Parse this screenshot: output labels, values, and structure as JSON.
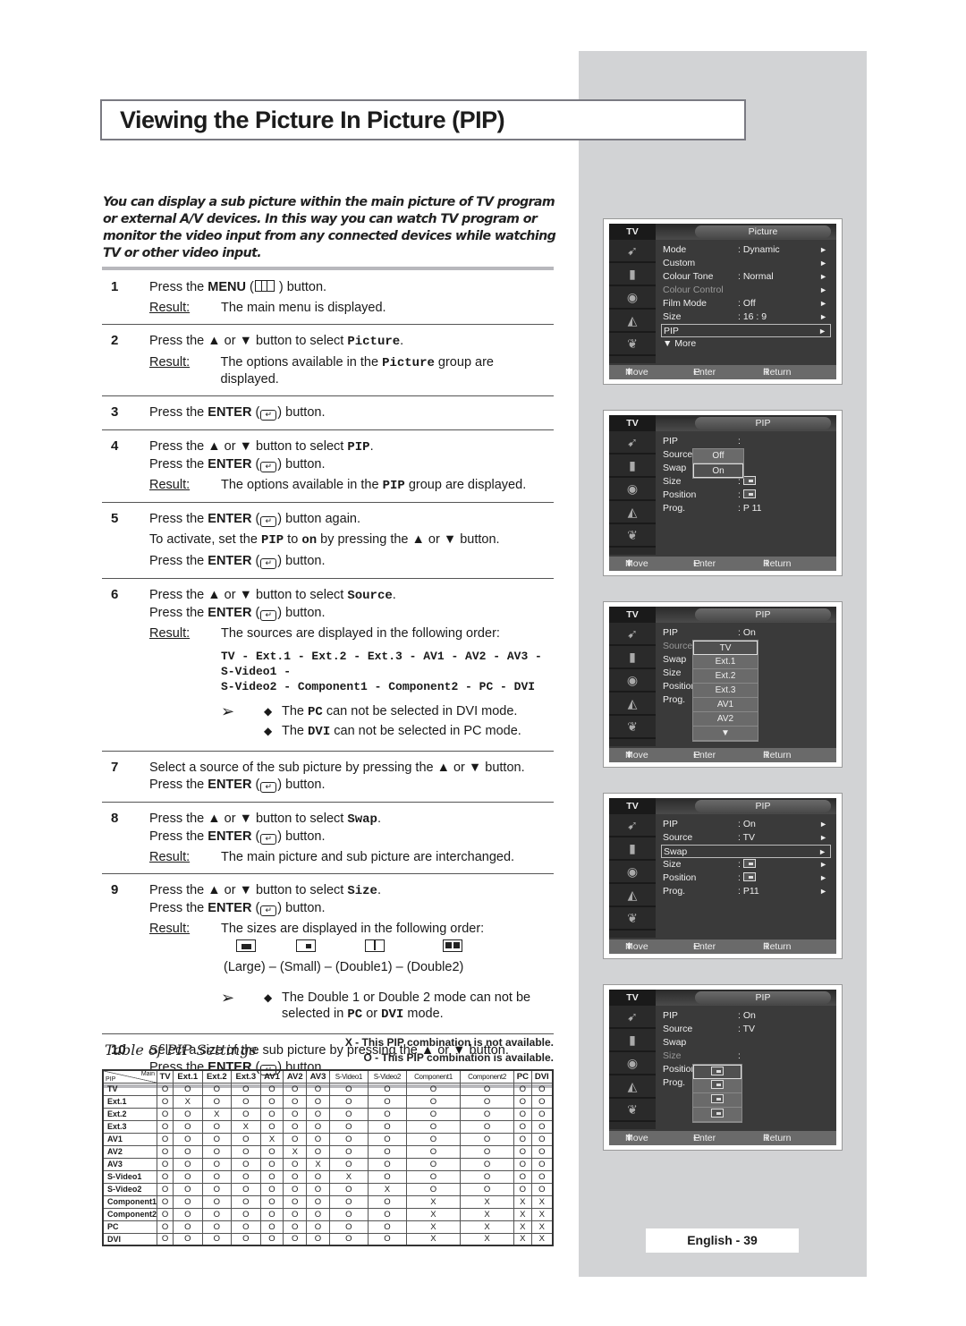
{
  "title": "Viewing the Picture In Picture (PIP)",
  "intro": "You can display a sub picture within the main picture of TV program or external A/V devices. In this way you can watch TV program or monitor the video input from any connected devices while watching TV or other video input.",
  "labels": {
    "result": "Result:",
    "press_the": "Press the",
    "menu": "MENU",
    "enter": "ENTER",
    "up": "▲",
    "down": "▼"
  },
  "steps": [
    {
      "num": "1",
      "lines": [
        "Press the MENU ( ) button."
      ],
      "result": "The main menu is displayed."
    },
    {
      "num": "2",
      "lines": [
        "Press the ▲ or ▼ button to select Picture."
      ],
      "result": "The options available in the Picture group are displayed."
    },
    {
      "num": "3",
      "lines": [
        "Press the ENTER ( ) button."
      ]
    },
    {
      "num": "4",
      "lines": [
        "Press the ▲ or ▼ button to select PIP.",
        "Press the ENTER ( ) button."
      ],
      "result": "The options available in the PIP group are displayed."
    },
    {
      "num": "5",
      "lines": [
        "Press the ENTER ( ) button again.",
        "To activate, set the PIP to on by pressing the ▲ or ▼ button.",
        "Press the ENTER ( ) button."
      ]
    },
    {
      "num": "6",
      "lines": [
        "Press the ▲ or ▼ button to select Source.",
        "Press the ENTER ( ) button."
      ],
      "result": "The sources are displayed in the following order:",
      "sources_line1": "TV - Ext.1 - Ext.2 - Ext.3 - AV1 - AV2 - AV3 - S-Video1 -",
      "sources_line2": "S-Video2 - Component1 - Component2 - PC - DVI",
      "notes": [
        "The PC can not be selected in DVI mode.",
        "The DVI can not be selected in PC mode."
      ]
    },
    {
      "num": "7",
      "lines": [
        "Select a source of the sub picture by pressing the ▲ or ▼ button.",
        "Press the ENTER ( ) button."
      ]
    },
    {
      "num": "8",
      "lines": [
        "Press the ▲ or ▼ button to select Swap.",
        "Press the ENTER ( ) button."
      ],
      "result": "The main picture and sub picture are interchanged."
    },
    {
      "num": "9",
      "lines": [
        "Press the ▲ or ▼ button to select Size.",
        "Press the ENTER ( ) button."
      ],
      "result": "The sizes are displayed in the following order:",
      "sizes": "(Large) – (Small) – (Double1) – (Double2)",
      "notes": [
        "The Double 1 or Double 2 mode can not be selected in PC or DVI mode."
      ]
    },
    {
      "num": "10",
      "lines": [
        "Select a size of the sub picture by pressing the ▲ or ▼ button.",
        "Press the ENTER ( ) button."
      ]
    }
  ],
  "step_parts": {
    "s1a": "Press the ",
    "s1b": "MENU",
    "s1c": " ( ",
    "s1d": " ) button.",
    "s2a": "Press the ▲ or ▼ button to select ",
    "s2b": "Picture",
    "s2c": ".",
    "s2r1": "The options available in the ",
    "s2r2": "Picture",
    "s2r3": " group are displayed.",
    "enter_a": "Press the ",
    "enter_b": "ENTER",
    "enter_c": " (",
    "enter_d": ") button.",
    "enter_again": ") button again.",
    "enter_glyph": "↵",
    "s4a": "Press the ▲ or ▼ button to select ",
    "s4b": "PIP",
    "s4c": ".",
    "s4r1": "The options available in the ",
    "s4r2": "PIP",
    "s4r3": " group are displayed.",
    "s5a": "To activate, set the ",
    "s5b": "PIP",
    "s5c": " to ",
    "s5d": "on",
    "s5e": " by pressing the ▲ or ▼ button.",
    "s6a": "Press the ▲ or ▼ button to select ",
    "s6b": "Source",
    "s6c": ".",
    "n1a": "The ",
    "n1b": "PC",
    "n1c": " can not be selected in DVI mode.",
    "n2a": "The ",
    "n2b": "DVI",
    "n2c": " can not be selected in PC mode.",
    "s8a": "Press the ▲ or ▼ button to select ",
    "s8b": "Swap",
    "s8c": ".",
    "s9a": "Press the ▲ or ▼ button to select ",
    "s9b": "Size",
    "s9c": ".",
    "n3a": "The Double 1 or Double 2 mode can not be",
    "n3b": "selected in ",
    "n3c": "PC",
    "n3d": " or ",
    "n3e": "DVI",
    "n3f": " mode.",
    "note_arrow": "➢"
  },
  "table": {
    "title": "Table of PIP Settings",
    "legend_x": "X - This PIP combination is not available.",
    "legend_o": "O - This PIP combination is available.",
    "corner_main": "Main",
    "corner_pip": "PIP",
    "columns": [
      "TV",
      "Ext.1",
      "Ext.2",
      "Ext.3",
      "AV1",
      "AV2",
      "AV3",
      "S-Video1",
      "S-Video2",
      "Component1",
      "Component2",
      "PC",
      "DVI"
    ],
    "rows": [
      {
        "name": "TV",
        "cells": [
          "O",
          "O",
          "O",
          "O",
          "O",
          "O",
          "O",
          "O",
          "O",
          "O",
          "O",
          "O",
          "O"
        ]
      },
      {
        "name": "Ext.1",
        "cells": [
          "O",
          "X",
          "O",
          "O",
          "O",
          "O",
          "O",
          "O",
          "O",
          "O",
          "O",
          "O",
          "O"
        ]
      },
      {
        "name": "Ext.2",
        "cells": [
          "O",
          "O",
          "X",
          "O",
          "O",
          "O",
          "O",
          "O",
          "O",
          "O",
          "O",
          "O",
          "O"
        ]
      },
      {
        "name": "Ext.3",
        "cells": [
          "O",
          "O",
          "O",
          "X",
          "O",
          "O",
          "O",
          "O",
          "O",
          "O",
          "O",
          "O",
          "O"
        ]
      },
      {
        "name": "AV1",
        "cells": [
          "O",
          "O",
          "O",
          "O",
          "X",
          "O",
          "O",
          "O",
          "O",
          "O",
          "O",
          "O",
          "O"
        ]
      },
      {
        "name": "AV2",
        "cells": [
          "O",
          "O",
          "O",
          "O",
          "O",
          "X",
          "O",
          "O",
          "O",
          "O",
          "O",
          "O",
          "O"
        ]
      },
      {
        "name": "AV3",
        "cells": [
          "O",
          "O",
          "O",
          "O",
          "O",
          "O",
          "X",
          "O",
          "O",
          "O",
          "O",
          "O",
          "O"
        ]
      },
      {
        "name": "S-Video1",
        "cells": [
          "O",
          "O",
          "O",
          "O",
          "O",
          "O",
          "O",
          "X",
          "O",
          "O",
          "O",
          "O",
          "O"
        ]
      },
      {
        "name": "S-Video2",
        "cells": [
          "O",
          "O",
          "O",
          "O",
          "O",
          "O",
          "O",
          "O",
          "X",
          "O",
          "O",
          "O",
          "O"
        ]
      },
      {
        "name": "Component1",
        "cells": [
          "O",
          "O",
          "O",
          "O",
          "O",
          "O",
          "O",
          "O",
          "O",
          "X",
          "X",
          "X",
          "X"
        ]
      },
      {
        "name": "Component2",
        "cells": [
          "O",
          "O",
          "O",
          "O",
          "O",
          "O",
          "O",
          "O",
          "O",
          "X",
          "X",
          "X",
          "X"
        ]
      },
      {
        "name": "PC",
        "cells": [
          "O",
          "O",
          "O",
          "O",
          "O",
          "O",
          "O",
          "O",
          "O",
          "X",
          "X",
          "X",
          "X"
        ]
      },
      {
        "name": "DVI",
        "cells": [
          "O",
          "O",
          "O",
          "O",
          "O",
          "O",
          "O",
          "O",
          "O",
          "X",
          "X",
          "X",
          "X"
        ]
      }
    ]
  },
  "osd_common": {
    "tv_label": "TV",
    "footer_move": "Move",
    "footer_enter": "Enter",
    "footer_return": "Return",
    "move_icon": "⬍",
    "enter_icon": "↵",
    "return_icon": "Ⅲ",
    "side_icons": [
      "antenna-icon",
      "picture-icon",
      "speaker-icon",
      "channel-icon",
      "setup-icon"
    ]
  },
  "osd_screens": [
    {
      "title": "Picture",
      "rows": [
        {
          "label": "Mode",
          "value": ": Dynamic",
          "arrow": "►"
        },
        {
          "label": "Custom",
          "value": "",
          "arrow": "►"
        },
        {
          "label": "Colour Tone",
          "value": ": Normal",
          "arrow": "►"
        },
        {
          "label": "Colour Control",
          "value": "",
          "arrow": "►",
          "dim": true
        },
        {
          "label": "Film Mode",
          "value": ": Off",
          "arrow": "►"
        },
        {
          "label": "Size",
          "value": ": 16 : 9",
          "arrow": "►"
        },
        {
          "label": "PIP",
          "value": "",
          "arrow": "►",
          "selected": true
        },
        {
          "label": "▼ More",
          "value": "",
          "arrow": ""
        }
      ]
    },
    {
      "title": "PIP",
      "rows": [
        {
          "label": "PIP",
          "value": ":",
          "arrow": ""
        },
        {
          "label": "Source",
          "value": ":",
          "arrow": ""
        },
        {
          "label": "Swap",
          "value": "",
          "arrow": ""
        },
        {
          "label": "Size",
          "value": ":",
          "icon": true,
          "arrow": ""
        },
        {
          "label": "Position",
          "value": ":",
          "icon": true,
          "arrow": ""
        },
        {
          "label": "Prog.",
          "value": ": P 11",
          "arrow": ""
        }
      ],
      "popup": [
        "Off",
        "On"
      ],
      "popup_selected": "On"
    },
    {
      "title": "PIP",
      "rows": [
        {
          "label": "PIP",
          "value": ": On",
          "arrow": ""
        },
        {
          "label": "Source",
          "value": ":",
          "arrow": "",
          "dim": true
        },
        {
          "label": "Swap",
          "value": "",
          "arrow": ""
        },
        {
          "label": "Size",
          "value": ":",
          "arrow": ""
        },
        {
          "label": "Position",
          "value": ":",
          "arrow": ""
        },
        {
          "label": "Prog.",
          "value": ":",
          "arrow": ""
        }
      ],
      "popup": [
        "TV",
        "Ext.1",
        "Ext.2",
        "Ext.3",
        "AV1",
        "AV2",
        "▼"
      ],
      "popup_selected": "TV"
    },
    {
      "title": "PIP",
      "rows": [
        {
          "label": "PIP",
          "value": ": On",
          "arrow": "►"
        },
        {
          "label": "Source",
          "value": ": TV",
          "arrow": "►"
        },
        {
          "label": "Swap",
          "value": "",
          "arrow": "►",
          "selected": true
        },
        {
          "label": "Size",
          "value": ":",
          "icon": true,
          "arrow": "►"
        },
        {
          "label": "Position",
          "value": ":",
          "icon": true,
          "arrow": "►"
        },
        {
          "label": "Prog.",
          "value": ": P11",
          "arrow": "►"
        }
      ]
    },
    {
      "title": "PIP",
      "rows": [
        {
          "label": "PIP",
          "value": ": On",
          "arrow": ""
        },
        {
          "label": "Source",
          "value": ": TV",
          "arrow": ""
        },
        {
          "label": "Swap",
          "value": "",
          "arrow": ""
        },
        {
          "label": "Size",
          "value": ":",
          "arrow": "",
          "dim": true
        },
        {
          "label": "Position",
          "value": ":",
          "arrow": ""
        },
        {
          "label": "Prog.",
          "value": ":",
          "arrow": ""
        }
      ],
      "popup": [
        "Large",
        "Small",
        "Double1",
        "Double2"
      ],
      "popup_selected": "Large",
      "popup_icons": true
    }
  ],
  "footer": "English - 39"
}
